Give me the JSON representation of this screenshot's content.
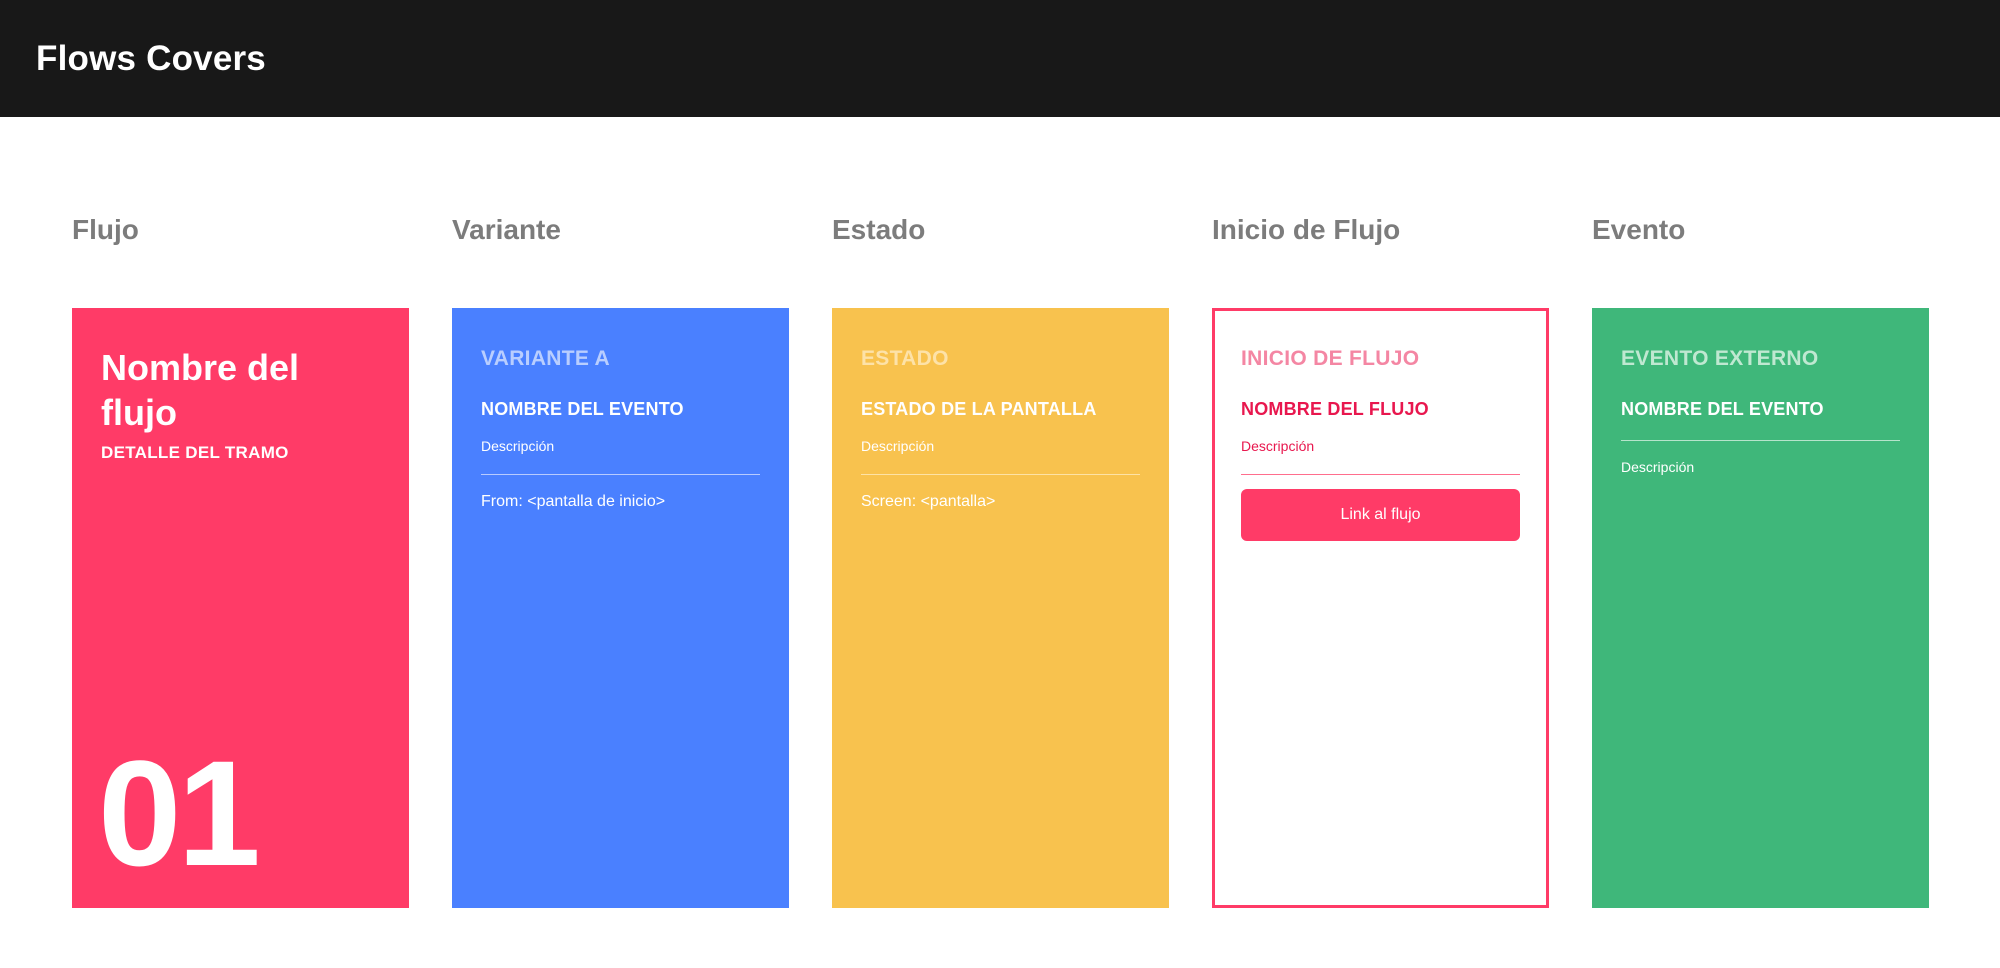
{
  "header": {
    "title": "Flows Covers"
  },
  "columns": {
    "flujo": {
      "label": "Flujo"
    },
    "variante": {
      "label": "Variante"
    },
    "estado": {
      "label": "Estado"
    },
    "inicio": {
      "label": "Inicio de Flujo"
    },
    "evento": {
      "label": "Evento"
    }
  },
  "cards": {
    "flujo": {
      "title": "Nombre del flujo",
      "detail": "DETALLE DEL TRAMO",
      "number": "01",
      "color": "#ff3b67"
    },
    "variante": {
      "title": "VARIANTE A",
      "name": "NOMBRE DEL EVENTO",
      "description": "Descripción",
      "extra": "From: <pantalla de inicio>",
      "color": "#4a80ff"
    },
    "estado": {
      "title": "ESTADO",
      "name": "ESTADO DE LA PANTALLA",
      "description": "Descripción",
      "extra": "Screen: <pantalla>",
      "color": "#f8c24e"
    },
    "inicio": {
      "title": "INICIO DE FLUJO",
      "name": "NOMBRE DEL FLUJO",
      "description": "Descripción",
      "button_label": "Link al flujo",
      "color": "#ff3b67"
    },
    "evento": {
      "title": "EVENTO EXTERNO",
      "name": "NOMBRE DEL EVENTO",
      "description": "Descripción",
      "color": "#3fb77a"
    }
  }
}
